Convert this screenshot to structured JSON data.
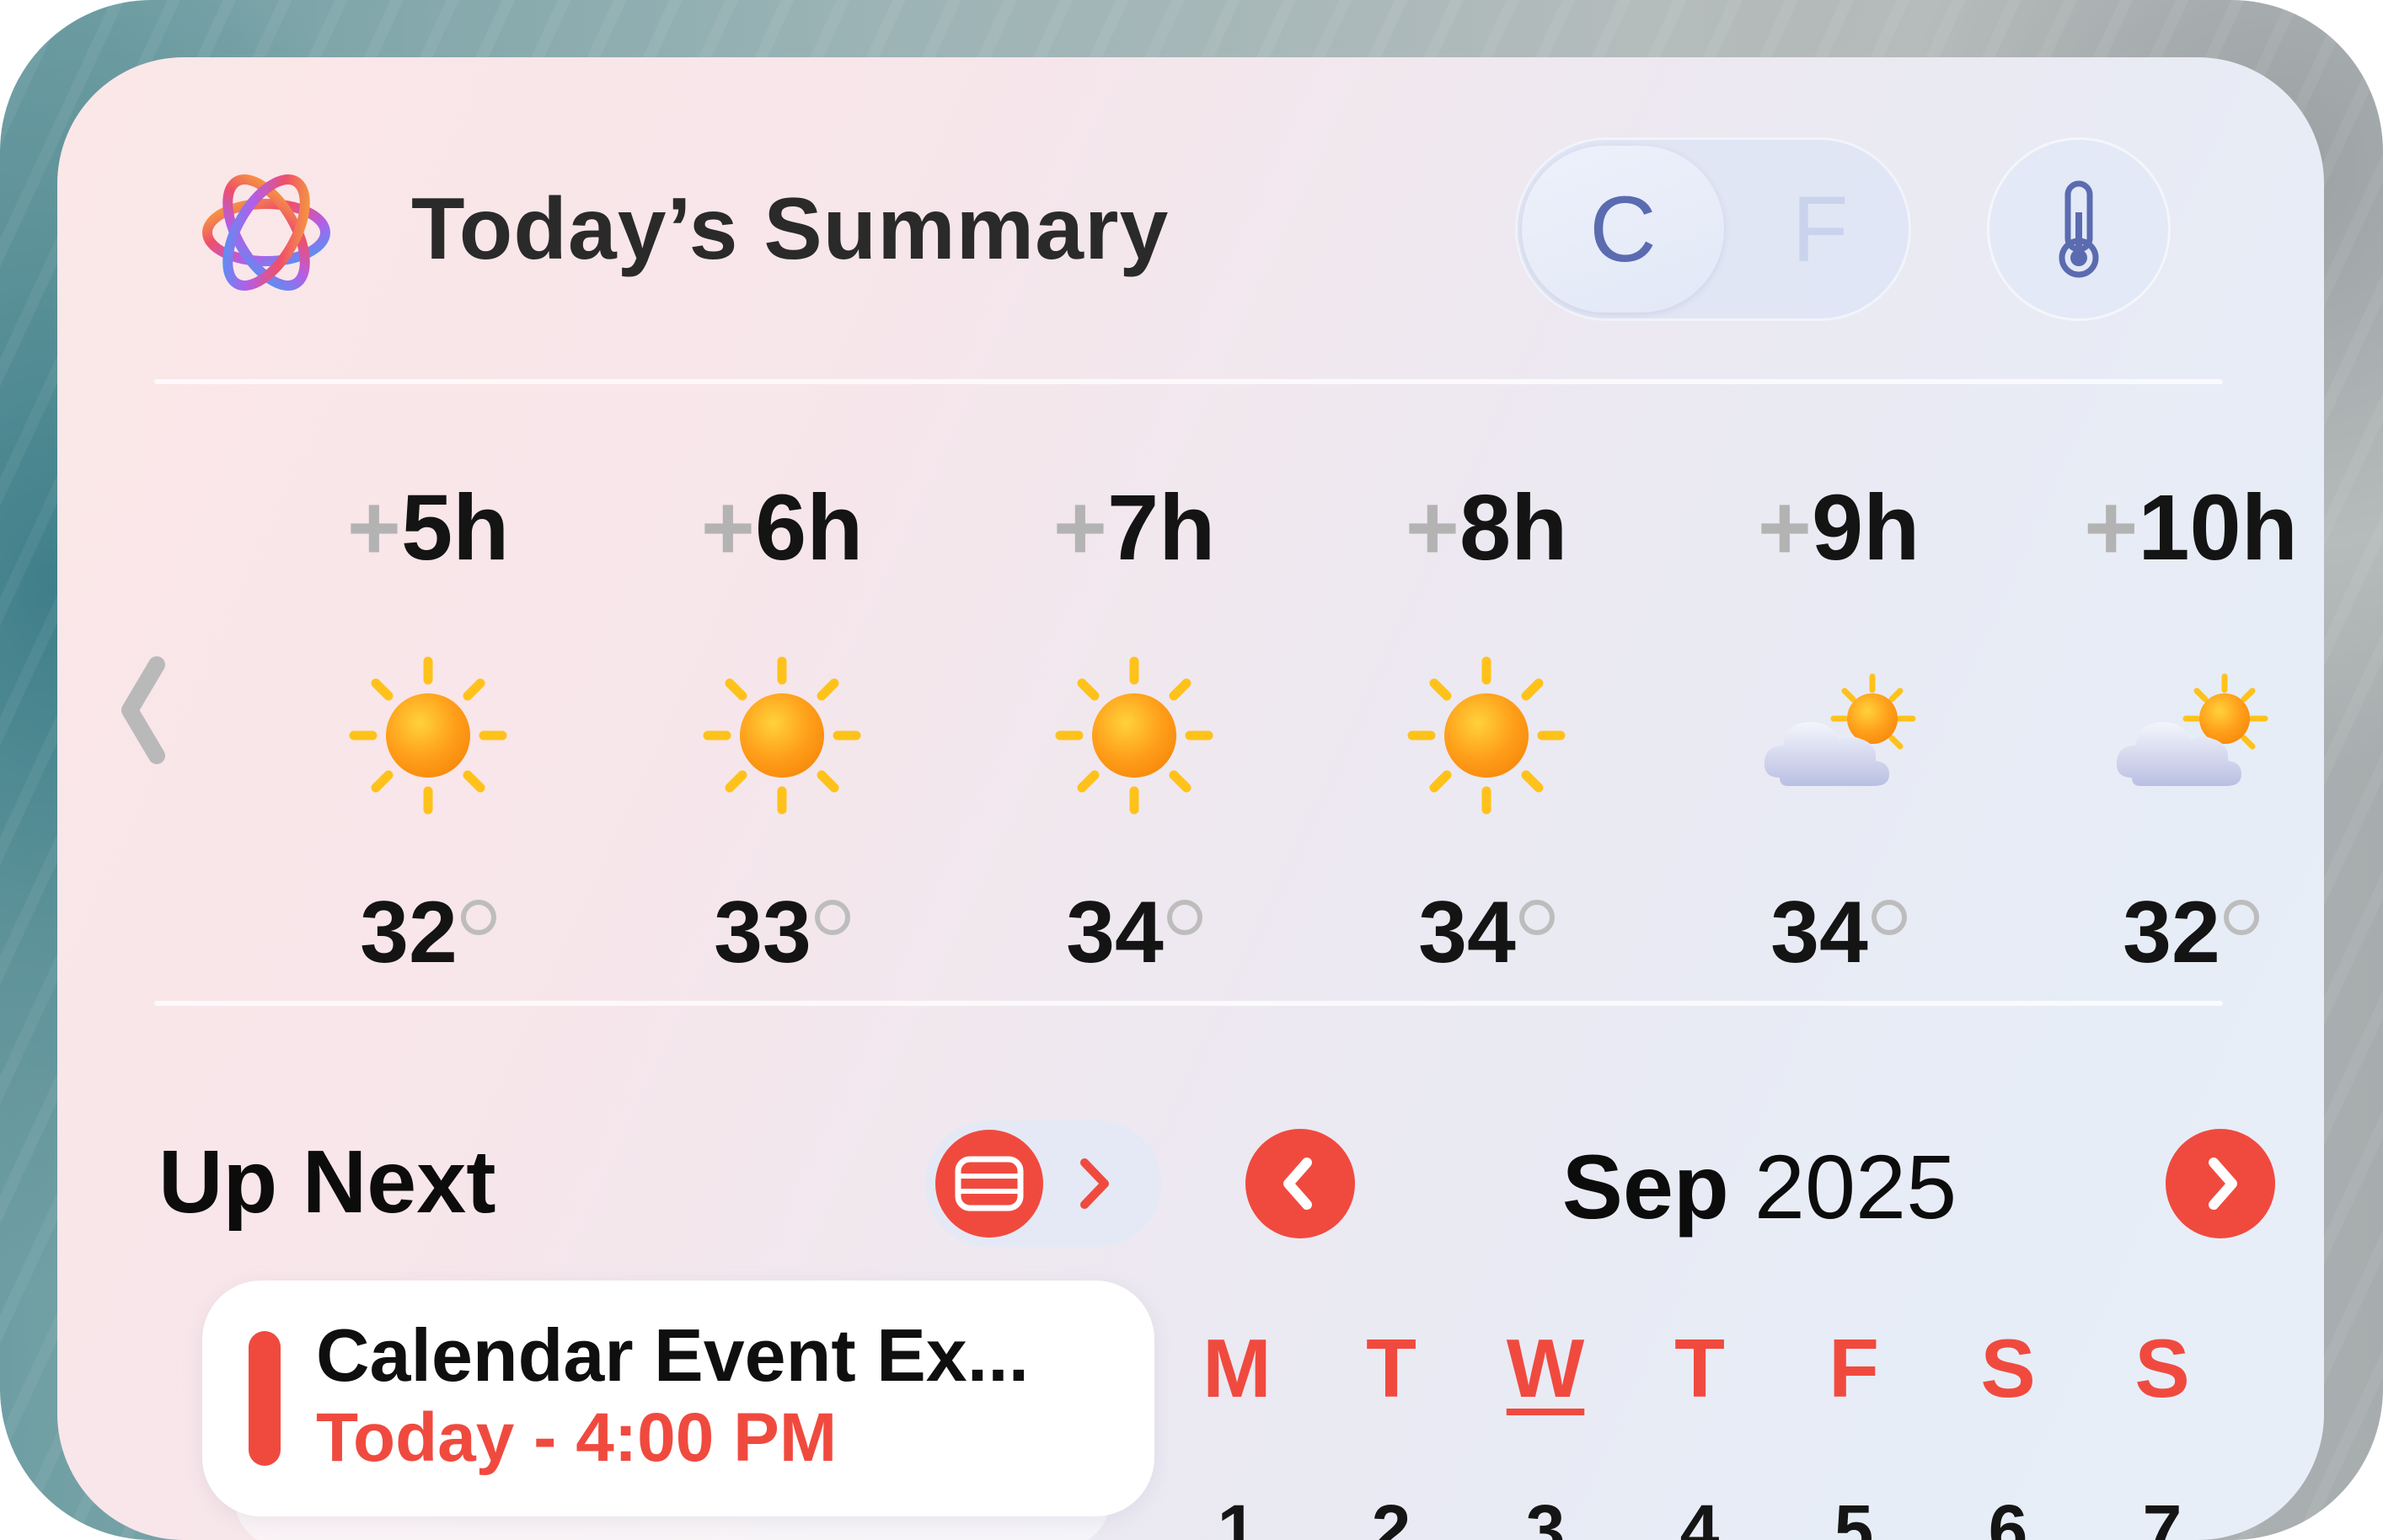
{
  "header": {
    "title": "Today’s Summary",
    "unit_toggle": {
      "celsius": "C",
      "fahrenheit": "F",
      "selected": "C"
    },
    "thermometer_icon": "thermometer-icon",
    "logo_icon": "apple-intelligence-icon"
  },
  "forecast": {
    "prev_icon": "chevron-left-icon",
    "hours": [
      {
        "plus": "+",
        "hour": "5h",
        "temp": "32",
        "icon": "sun-icon"
      },
      {
        "plus": "+",
        "hour": "6h",
        "temp": "33",
        "icon": "sun-icon"
      },
      {
        "plus": "+",
        "hour": "7h",
        "temp": "34",
        "icon": "sun-icon"
      },
      {
        "plus": "+",
        "hour": "8h",
        "temp": "34",
        "icon": "sun-icon"
      },
      {
        "plus": "+",
        "hour": "9h",
        "temp": "34",
        "icon": "partly-cloudy-icon"
      },
      {
        "plus": "+",
        "hour": "10h",
        "temp": "32",
        "icon": "partly-cloudy-icon"
      }
    ]
  },
  "up_next": {
    "title": "Up Next",
    "list_icon": "list-icon",
    "more_icon": "chevron-right-icon",
    "event": {
      "title": "Calendar Event Ex...",
      "time": "Today - 4:00 PM"
    }
  },
  "calendar": {
    "month": "Sep",
    "year": "2025",
    "prev_icon": "chevron-left-icon",
    "next_icon": "chevron-right-icon",
    "weekdays": [
      "M",
      "T",
      "W",
      "T",
      "F",
      "S",
      "S"
    ],
    "today_weekday_index": 2,
    "days": [
      "1",
      "2",
      "3",
      "4",
      "5",
      "6",
      "7"
    ]
  },
  "colors": {
    "accent": "#f04a3f",
    "toggle_active": "#5b6bb0",
    "toggle_inactive": "#c9d3ec"
  }
}
